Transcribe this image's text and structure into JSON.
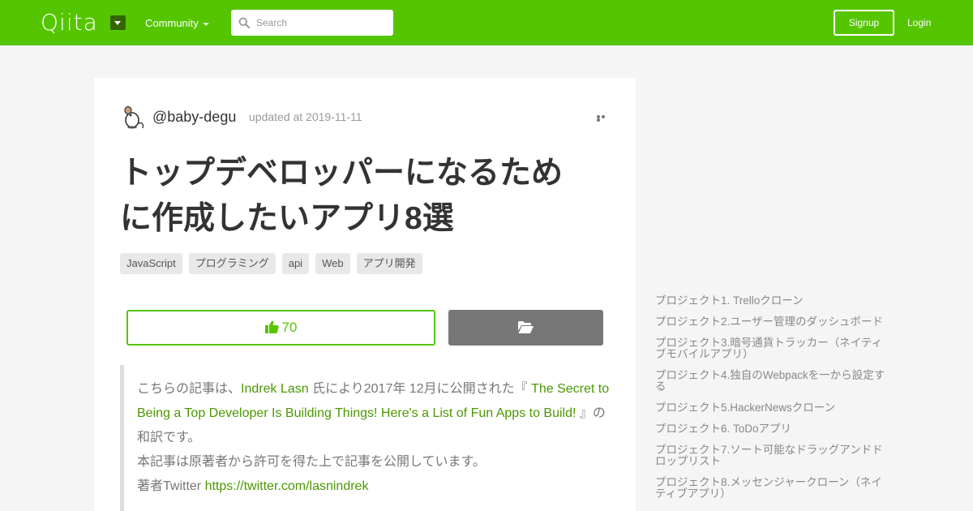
{
  "header": {
    "logo": "Qiita",
    "community": "Community",
    "search_placeholder": "Search",
    "signup": "Signup",
    "login": "Login"
  },
  "article": {
    "username": "@baby-degu",
    "updated": "updated at 2019-11-11",
    "title_line1": "トップデベロッパーになるため",
    "title_line2": "に作成したいアプリ8選",
    "tags": [
      "JavaScript",
      "プログラミング",
      "api",
      "Web",
      "アプリ開発"
    ],
    "like_count": "70",
    "quote": {
      "t1": "こちらの記事は、",
      "author": "Indrek Lasn",
      "t2": " 氏により2017年 12月に公開された『 ",
      "article_title": "The Secret to Being a Top Developer Is Building Things! Here's a List of Fun Apps to Build!",
      "t3": " 』の和訳です。",
      "line2": "本記事は原著者から許可を得た上で記事を公開しています。",
      "twitter_label": "著者Twitter ",
      "twitter_url": "https://twitter.com/lasnindrek"
    }
  },
  "toc": [
    "プロジェクト1. Trelloクローン",
    "プロジェクト2.ユーザー管理のダッシュボード",
    "プロジェクト3.暗号通貨トラッカー（ネイティブモバイルアプリ）",
    "プロジェクト4.独自のWebpackを一から設定する",
    "プロジェクト5.HackerNewsクローン",
    "プロジェクト6. ToDoアプリ",
    "プロジェクト7.ソート可能なドラッグアンドドロップリスト",
    "プロジェクト8.メッセンジャークローン（ネイティブアプリ）"
  ],
  "colors": {
    "brand": "#55c500",
    "link": "#4b9800",
    "stock_button": "#777777"
  }
}
